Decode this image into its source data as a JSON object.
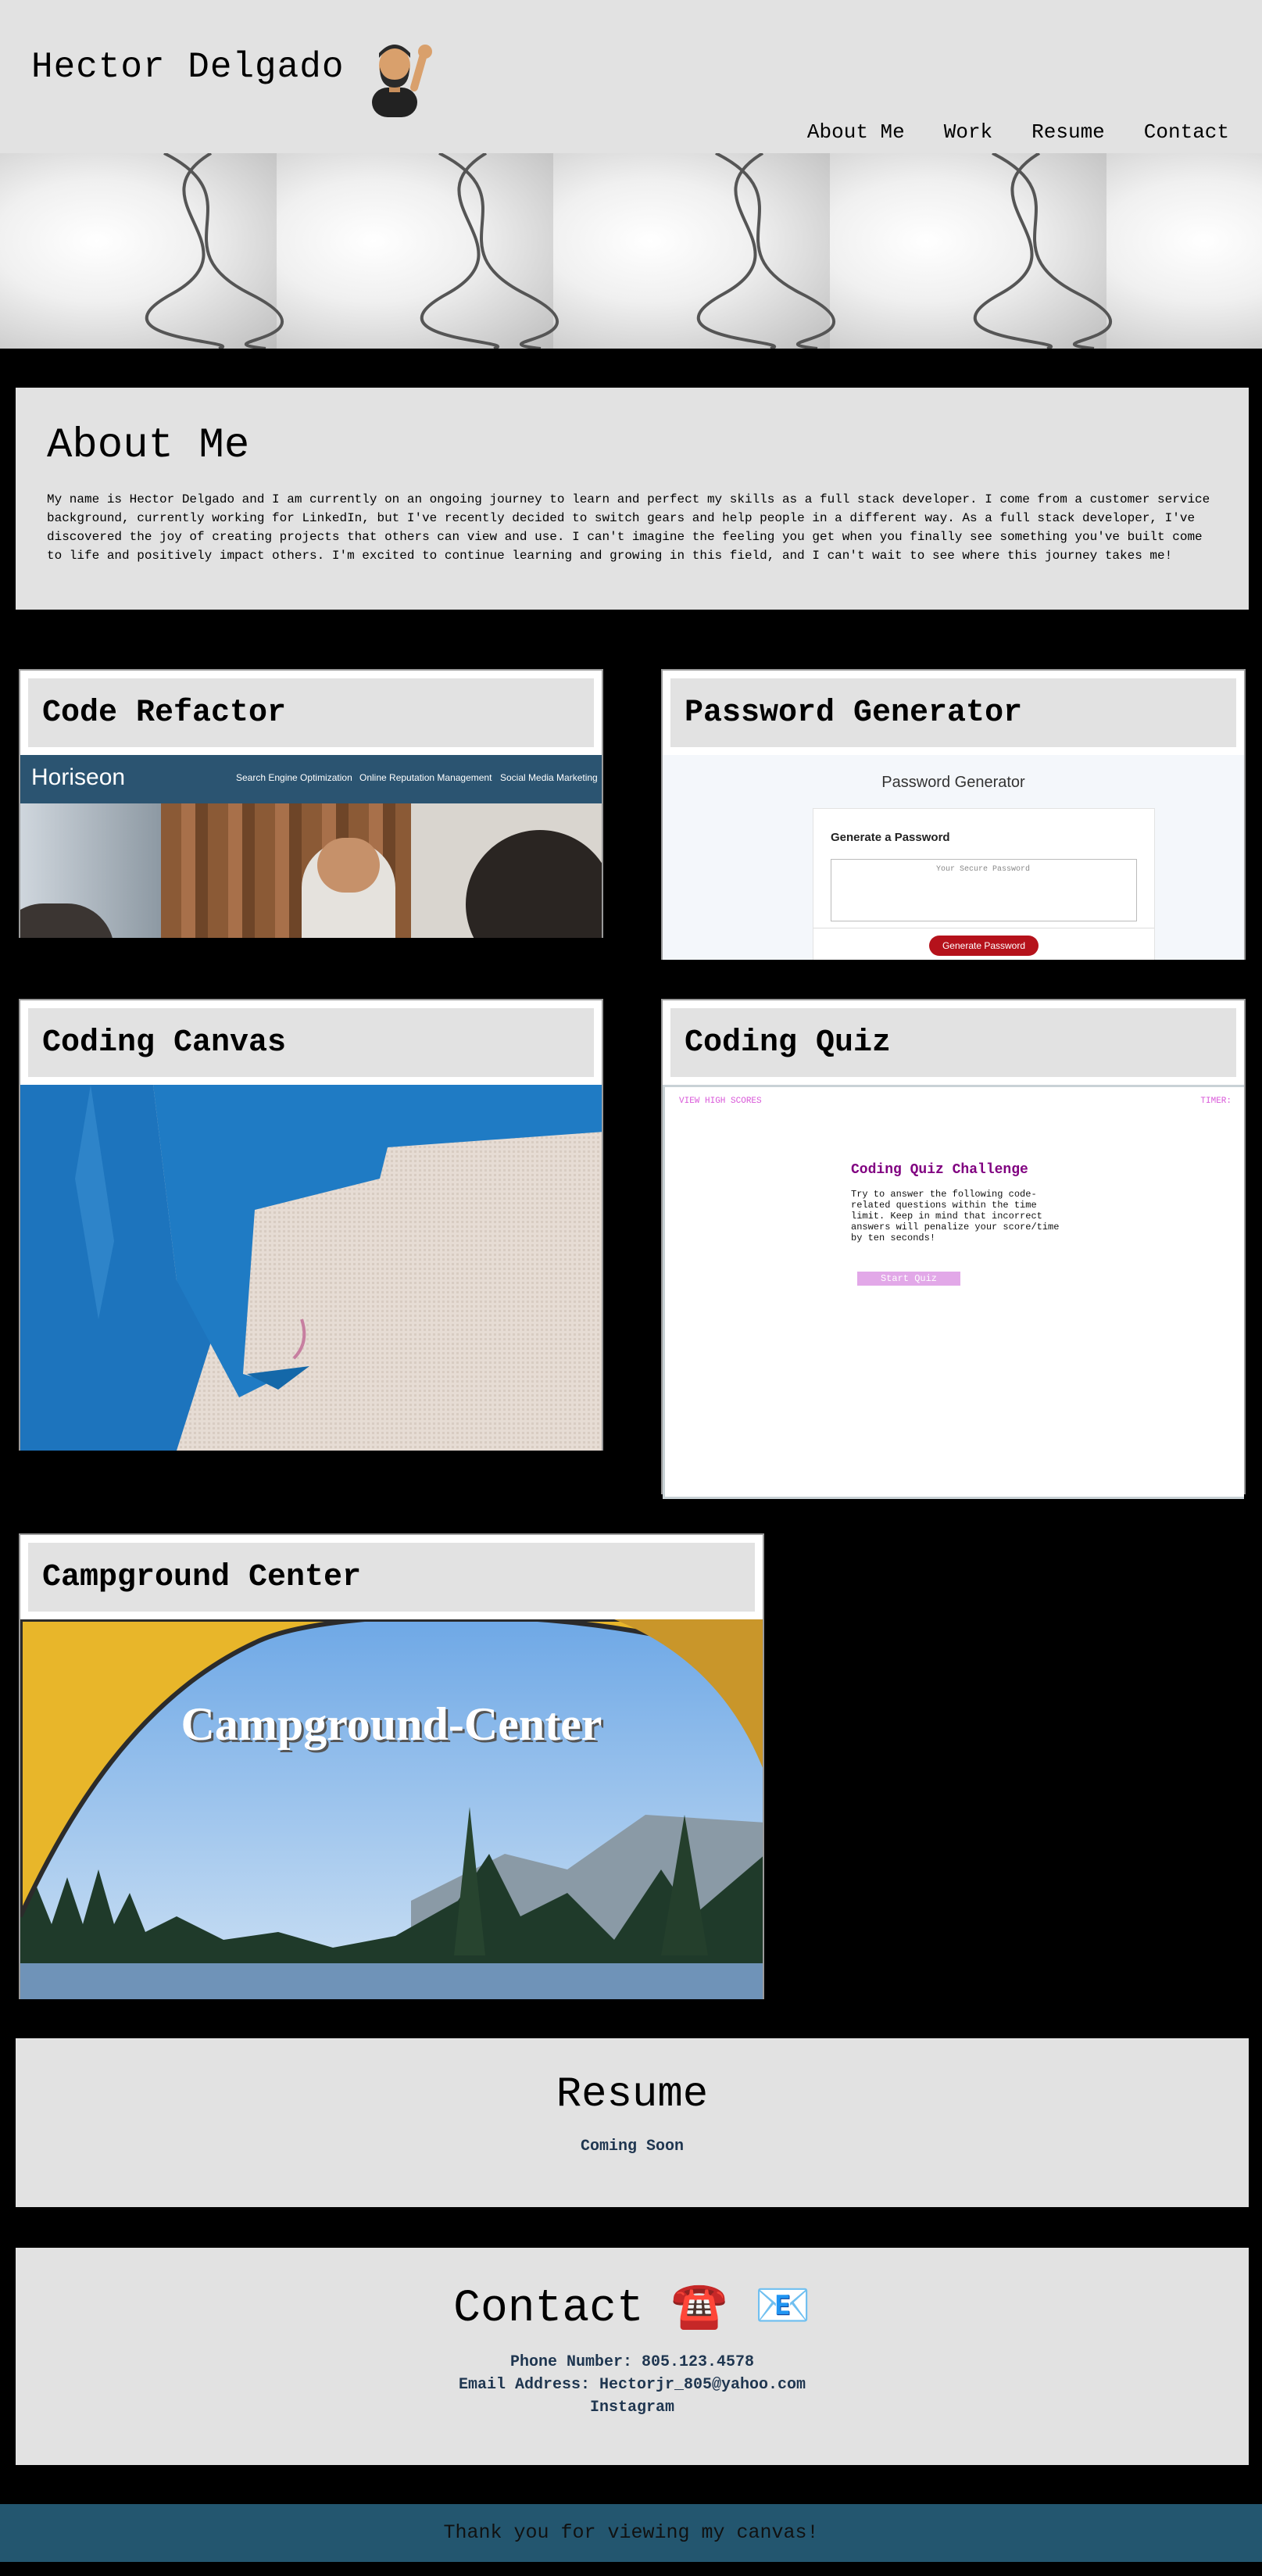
{
  "header": {
    "title": "Hector Delgado",
    "nav": [
      "About Me",
      "Work",
      "Resume",
      "Contact"
    ]
  },
  "about": {
    "title": "About Me",
    "text": "My name is Hector Delgado and I am currently on an ongoing journey to learn and perfect my skills as a full stack developer. I come from a customer service background, currently working for LinkedIn, but I've recently decided to switch gears and help people in a different way. As a full stack developer, I've discovered the joy of creating projects that others can view and use. I can't imagine the feeling you get when you finally see something you've built come to life and positively impact others. I'm excited to continue learning and growing in this field, and I can't wait to see where this journey takes me!"
  },
  "projects": [
    {
      "title": "Code Refactor",
      "preview": {
        "brand": "Horiseon",
        "nav": [
          "Search Engine Optimization",
          "Online Reputation Management",
          "Social Media Marketing"
        ]
      }
    },
    {
      "title": "Password Generator",
      "preview": {
        "heading": "Password Generator",
        "card_title": "Generate a Password",
        "placeholder": "Your Secure Password",
        "button": "Generate Password"
      }
    },
    {
      "title": "Coding Canvas"
    },
    {
      "title": "Coding Quiz",
      "preview": {
        "high_scores": "VIEW HIGH SCORES",
        "timer": "TIMER:",
        "heading": "Coding Quiz Challenge",
        "text": "Try to answer the following code-related questions within the time limit. Keep in mind that incorrect answers will penalize your score/time by ten seconds!",
        "button": "Start Quiz"
      }
    },
    {
      "title": "Campground Center",
      "preview": {
        "banner": "Campground-Center"
      }
    }
  ],
  "resume": {
    "title": "Resume",
    "status": "Coming Soon"
  },
  "contact": {
    "title": "Contact",
    "phone_icon": "☎️",
    "email_icon": "📧",
    "phone": "Phone Number: 805.123.4578",
    "email": "Email Address: Hectorjr_805@yahoo.com",
    "instagram": "Instagram"
  },
  "footer": {
    "text": "Thank you for viewing my canvas!"
  },
  "colors": {
    "panel": "#e2e2e2",
    "footer": "#23566f",
    "link": "#1f3650",
    "quiz_accent": "#800080"
  }
}
